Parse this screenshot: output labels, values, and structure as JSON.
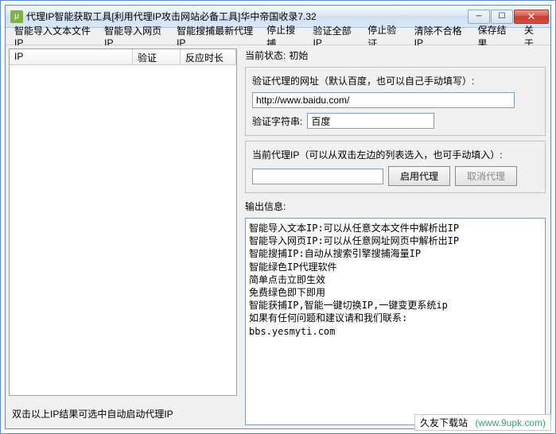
{
  "window": {
    "title": "代理IP智能获取工具[利用代理IP攻击网站必备工具]华中帝国收录7.32"
  },
  "menu": {
    "items": [
      "智能导入文本文件IP",
      "智能导入网页IP",
      "智能搜捕最新代理IP",
      "停止搜捕",
      "验证全部IP",
      "停止验证",
      "清除不合格IP",
      "保存结果",
      "关于"
    ]
  },
  "table": {
    "headers": [
      "IP",
      "验证",
      "反应时长"
    ]
  },
  "left_hint": "双击以上IP结果可选中自动启动代理IP",
  "status": {
    "label": "当前状态:",
    "value": "初始"
  },
  "verify": {
    "url_label": "验证代理的网址（默认百度，也可以自己手动填写）:",
    "url_value": "http://www.baidu.com/",
    "str_label": "验证字符串:",
    "str_value": "百度"
  },
  "proxy": {
    "label": "当前代理IP（可以从双击左边的列表选入，也可手动填入）:",
    "ip_value": "",
    "start_btn": "启用代理",
    "cancel_btn": "取消代理"
  },
  "output": {
    "label": "输出信息:",
    "text": "智能导入文本IP:可以从任意文本文件中解析出IP\n智能导入网页IP:可以从任意网址网页中解析出IP\n智能搜捕IP:自动从搜索引擎搜捕海量IP\n智能绿色IP代理软件\n简单点击立即生效\n免费绿色即下即用\n智能获捕IP,智能一键切换IP,一键变更系统ip\n如果有任何问题和建议请和我们联系:\nbbs.yesmyti.com"
  },
  "watermark": {
    "name": "久友下载站",
    "url": "(www.9upk.com)"
  }
}
